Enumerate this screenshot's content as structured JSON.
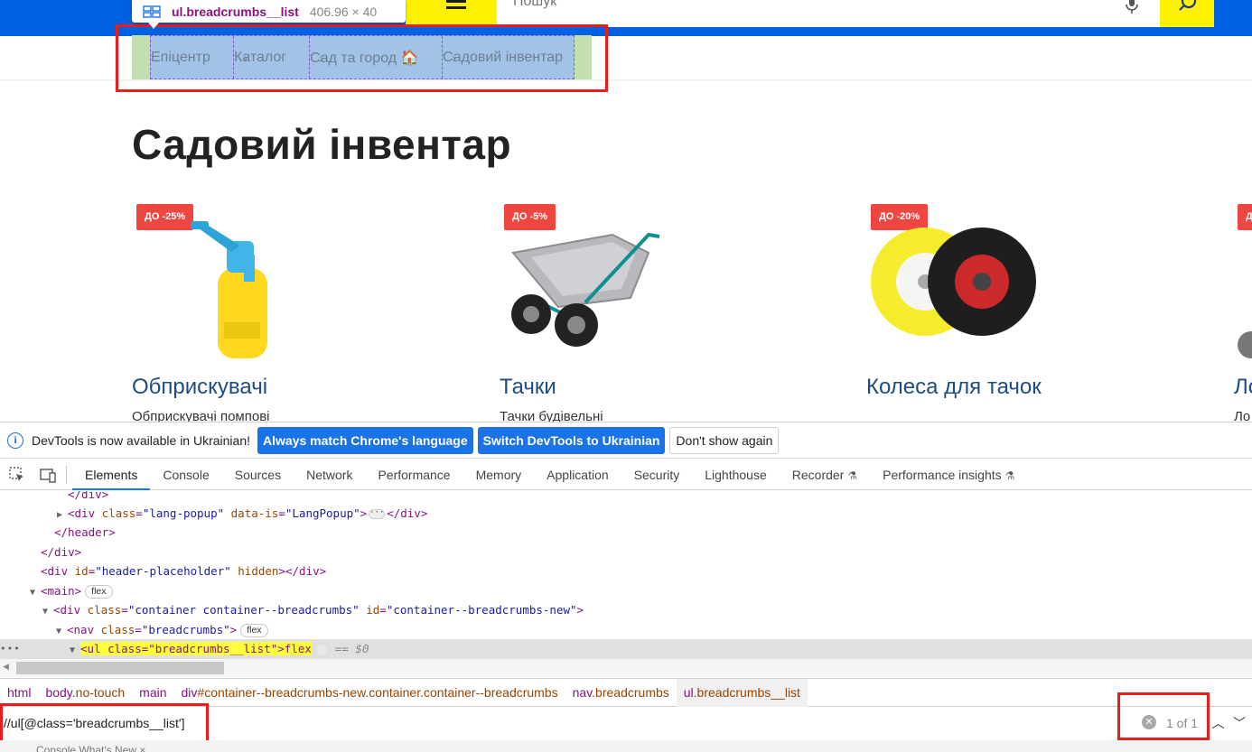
{
  "site": {
    "search_placeholder": "Пошук",
    "tooltip": {
      "tag": "ul.breadcrumbs__list",
      "dims": "406.96 × 40"
    },
    "breadcrumbs": [
      "Епіцентр",
      "Каталог",
      "Сад та город 🏠",
      "Садовий інвентар"
    ],
    "title": "Садовий інвентар",
    "cards": [
      {
        "badge": "ДО -25%",
        "name": "Обприскувачі",
        "sub": "Обприскувачі помпові"
      },
      {
        "badge": "ДО -5%",
        "name": "Тачки",
        "sub": "Тачки будівельні"
      },
      {
        "badge": "ДО -20%",
        "name": "Колеса для тачок",
        "sub": ""
      },
      {
        "badge": "Д",
        "name": "Ло",
        "sub": "Ло"
      }
    ]
  },
  "devtools": {
    "infobar": {
      "text": "DevTools is now available in Ukrainian!",
      "btn_match": "Always match Chrome's language",
      "btn_switch": "Switch DevTools to Ukrainian",
      "btn_dismiss": "Don't show again"
    },
    "tabs": [
      "Elements",
      "Console",
      "Sources",
      "Network",
      "Performance",
      "Memory",
      "Application",
      "Security",
      "Lighthouse",
      "Recorder",
      "Performance insights"
    ],
    "dom": {
      "l0": "</div>",
      "l1_tag": "<div",
      "l1_attr": "class",
      "l1_val": "\"lang-popup\"",
      "l1_attr2": "data-is",
      "l1_val2": "\"LangPopup\"",
      "l1_close": "</div>",
      "l2": "</header>",
      "l3": "</div>",
      "l4_attr": "id",
      "l4_val": "\"header-placeholder\"",
      "l4_attr2": "hidden",
      "l5_tag": "<main>",
      "l5_chip": "flex",
      "l6_val": "\"container container--breadcrumbs\"",
      "l6_val2": "\"container--breadcrumbs-new\"",
      "l7_val": "\"breadcrumbs\"",
      "l7_chip": "flex",
      "l8_hl": "<ul class=\"breadcrumbs__list\">",
      "l8_flex": "flex",
      "l8_eq": "== $0"
    },
    "crumbs": [
      {
        "tag": "html",
        "rest": ""
      },
      {
        "tag": "body",
        "rest": ".no-touch"
      },
      {
        "tag": "main",
        "rest": ""
      },
      {
        "tag": "div",
        "rest": "#container--breadcrumbs-new.container.container--breadcrumbs"
      },
      {
        "tag": "nav",
        "rest": ".breadcrumbs"
      },
      {
        "tag": "ul",
        "rest": ".breadcrumbs__list"
      }
    ],
    "search": {
      "value": "//ul[@class='breadcrumbs__list']",
      "count": "1 of 1"
    },
    "bottom_text": "Console    What's New  ×"
  }
}
